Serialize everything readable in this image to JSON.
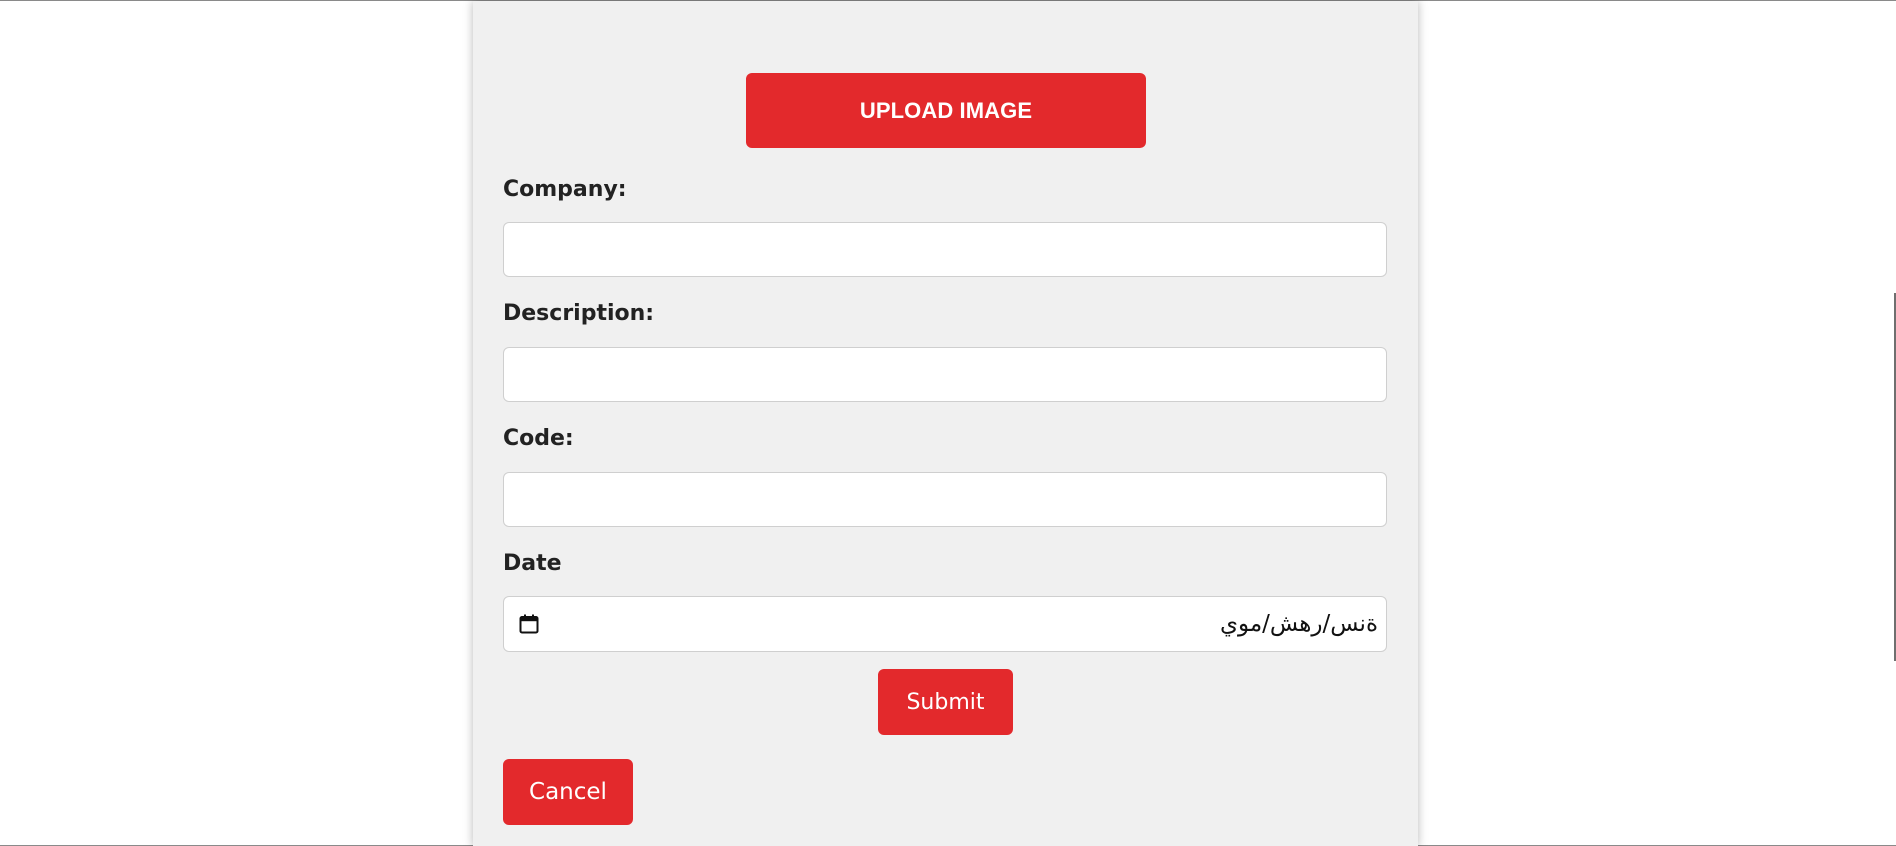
{
  "form": {
    "upload_button": "UPLOAD IMAGE",
    "fields": [
      {
        "label": "Company:",
        "value": "",
        "placeholder": ""
      },
      {
        "label": "Description:",
        "value": "",
        "placeholder": ""
      },
      {
        "label": "Code:",
        "value": "",
        "placeholder": ""
      }
    ],
    "date": {
      "label": "Date",
      "placeholder": "ةنس/رهش/موي",
      "icon": "calendar-icon"
    },
    "submit_button": "Submit",
    "cancel_button": "Cancel"
  },
  "colors": {
    "accent": "#e3292c",
    "card_background": "#f0f0f0",
    "page_background": "#ffffff",
    "label_text": "#222222"
  }
}
